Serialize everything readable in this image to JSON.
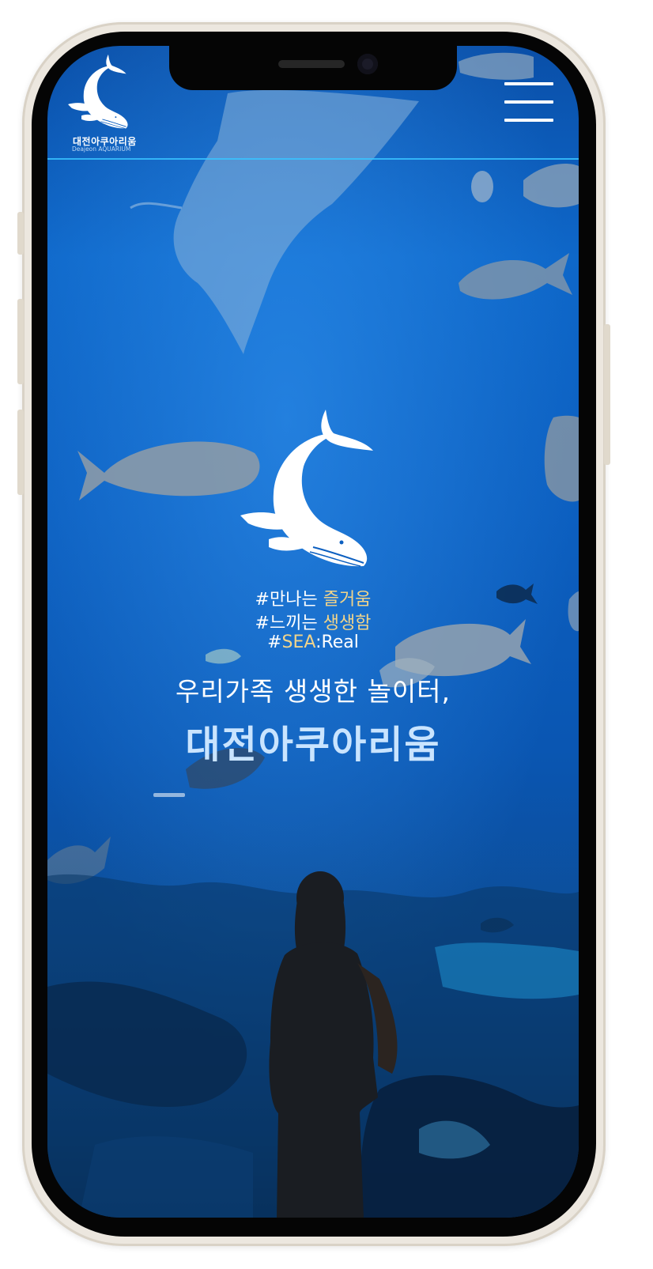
{
  "header": {
    "logo_name": "대전아쿠아리움",
    "logo_sub": "Deajeon AQUARIUM"
  },
  "hero": {
    "tags": [
      {
        "prefix": "#만나는 ",
        "highlight": "즐거움",
        "suffix": ""
      },
      {
        "prefix": "#느끼는 ",
        "highlight": "생생함",
        "suffix": ""
      },
      {
        "prefix": "#",
        "highlight": "SEA",
        "suffix": ":Real"
      }
    ],
    "subtitle": "우리가족 생생한 놀이터,",
    "title": "대전아쿠아리움"
  },
  "colors": {
    "ocean": "#0c5fc0",
    "accent_line": "#38c2ff",
    "highlight": "#f1d48a",
    "title": "#c9e4ff"
  }
}
